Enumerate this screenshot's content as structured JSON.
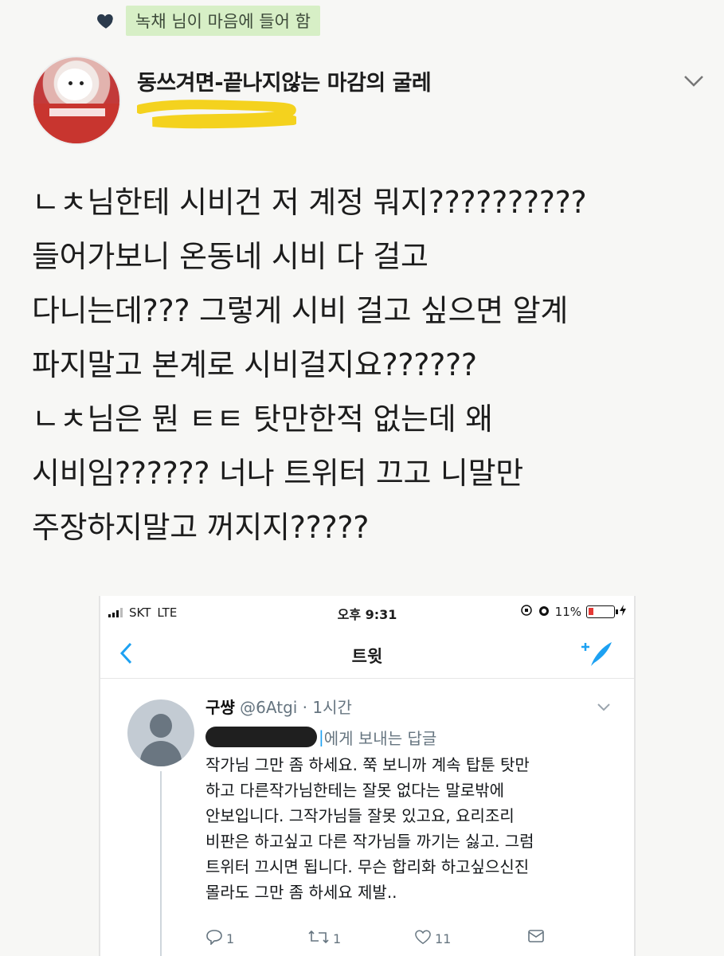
{
  "liked_notice": {
    "text": "녹채 님이 마음에 들어 함",
    "highlight_color": "#d7efc6"
  },
  "tweet": {
    "display_name": "동쓰겨면-끝나지않는 마감의 굴레",
    "lines": [
      "ㄴㅊ님한테 시비건 저 계정 뭐지??????????",
      "들어가보니 온동네 시비 다 걸고",
      "다니는데??? 그렇게 시비 걸고 싶으면 알계",
      "파지말고 본계로 시비걸지요??????",
      "ㄴㅊ님은 뭔 ㅌㅌ 탓만한적 없는데 왜",
      "시비임?????? 너나 트위터 끄고 니말만",
      "주장하지말고 꺼지지?????"
    ]
  },
  "embedded_screenshot": {
    "status_bar": {
      "carrier": "SKT",
      "network": "LTE",
      "time": "오후 9:31",
      "battery": "11%"
    },
    "nav": {
      "title": "트윗"
    },
    "reply": {
      "name": "구썅",
      "meta": "@6Atgi · 1시간",
      "replying_to": "에게 보내는 답글",
      "body_lines": [
        "작가님 그만 좀 하세요. 쭉 보니까 계속 탑툰 탓만",
        "하고 다른작가님한테는 잘못 없다는 말로밖에",
        "안보입니다. 그작가님들 잘못 있고요, 요리조리",
        "비판은 하고싶고 다른 작가님들 까기는 싫고. 그럼",
        "트위터 끄시면 됩니다. 무슨 합리화 하고싶으신진",
        "몰라도 그만 좀 하세요 제발.."
      ],
      "actions": {
        "replies": "1",
        "retweets": "1",
        "likes": "11"
      }
    },
    "accent_color": "#1da1f2"
  }
}
